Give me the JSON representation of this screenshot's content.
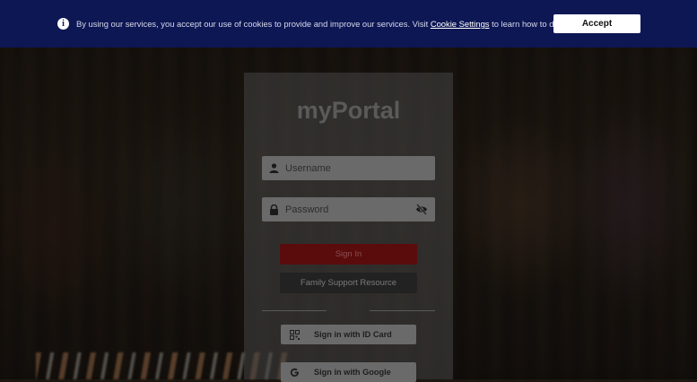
{
  "cookie_banner": {
    "text_before": "By using our services, you accept our use of cookies to provide and improve our services. Visit ",
    "link_text": "Cookie Settings",
    "text_after": " to learn how to disable them.",
    "accept_label": "Accept",
    "icon": "info-icon",
    "background": "#0d1754"
  },
  "login": {
    "brand": "myPortal",
    "username_placeholder": "Username",
    "password_placeholder": "Password",
    "sign_in_label": "Sign In",
    "family_support_label": "Family Support Resource",
    "or_label": "OR",
    "id_card_label": "Sign in with ID Card",
    "google_label": "Sign in with Google",
    "accent": "#5a0c0c"
  }
}
